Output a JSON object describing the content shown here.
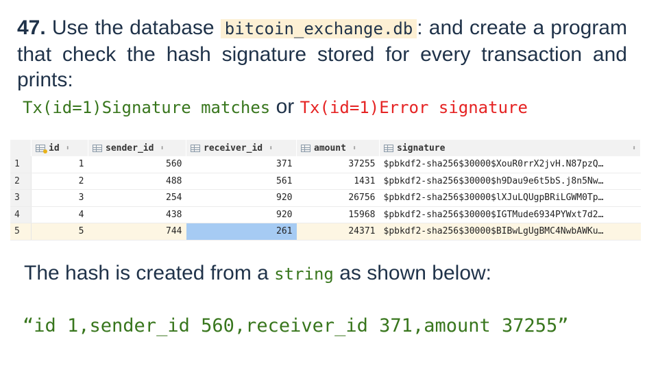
{
  "question": {
    "number": "47.",
    "text_before": " Use the database ",
    "db_name": "bitcoin_exchange.db",
    "text_after": ": and create a program that check the hash signature stored for every transaction and prints:"
  },
  "outputs": {
    "match_text": "Tx(id=1)Signature matches",
    "or_text": " or ",
    "error_text": "Tx(id=1)Error signature"
  },
  "table": {
    "columns": [
      "id",
      "sender_id",
      "receiver_id",
      "amount",
      "signature"
    ],
    "rows": [
      {
        "rownum": "1",
        "id": "1",
        "sender_id": "560",
        "receiver_id": "371",
        "amount": "37255",
        "signature": "$pbkdf2-sha256$30000$XouR0rrX2jvH.N87pzQ…"
      },
      {
        "rownum": "2",
        "id": "2",
        "sender_id": "488",
        "receiver_id": "561",
        "amount": "1431",
        "signature": "$pbkdf2-sha256$30000$h9Dau9e6t5bS.j8n5Nw…"
      },
      {
        "rownum": "3",
        "id": "3",
        "sender_id": "254",
        "receiver_id": "920",
        "amount": "26756",
        "signature": "$pbkdf2-sha256$30000$lXJuLQUgpBRiLGWM0Tp…"
      },
      {
        "rownum": "4",
        "id": "4",
        "sender_id": "438",
        "receiver_id": "920",
        "amount": "15968",
        "signature": "$pbkdf2-sha256$30000$IGTMude6934PYWxt7d2…"
      },
      {
        "rownum": "5",
        "id": "5",
        "sender_id": "744",
        "receiver_id": "261",
        "amount": "24371",
        "signature": "$pbkdf2-sha256$30000$BIBwLgUgBMC4NwbAWKu…"
      }
    ],
    "selected_row": 5,
    "selected_cell": "receiver_id"
  },
  "footer": {
    "hash_before": "The hash is created from a ",
    "hash_code": "string",
    "hash_after": " as shown below:",
    "example_string": "“id 1,sender_id 560,receiver_id 371,amount 37255”"
  },
  "colors": {
    "heading": "#1f3249",
    "green_code": "#38761d",
    "red_code": "#e52222",
    "db_highlight": "#fdf0d4",
    "selected_cell": "#a6cbf3"
  }
}
